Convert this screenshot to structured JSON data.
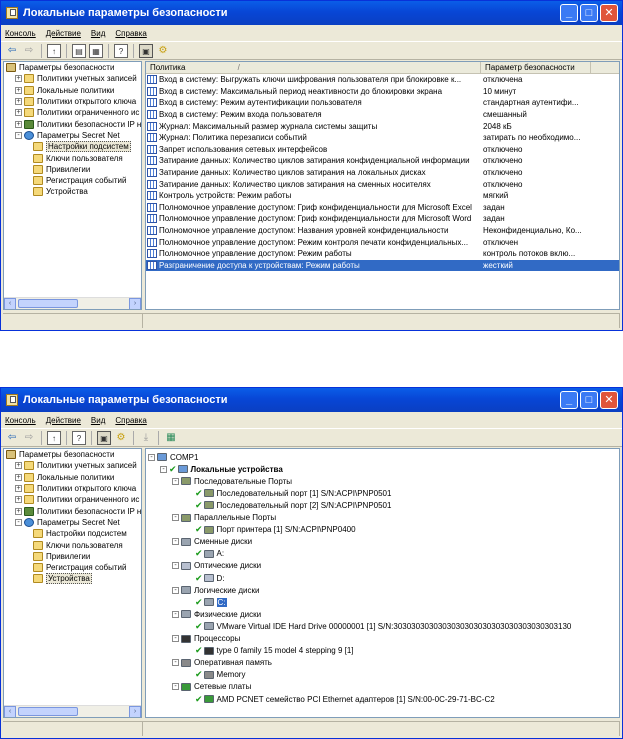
{
  "window_title": "Локальные параметры безопасности",
  "menu": [
    "Консоль",
    "Действие",
    "Вид",
    "Справка"
  ],
  "tree": [
    {
      "label": "Параметры безопасности",
      "level": 0,
      "exp": "",
      "icon": "root"
    },
    {
      "label": "Политики учетных записей",
      "level": 1,
      "exp": "+",
      "icon": "folder"
    },
    {
      "label": "Локальные политики",
      "level": 1,
      "exp": "+",
      "icon": "folder"
    },
    {
      "label": "Политики открытого ключа",
      "level": 1,
      "exp": "+",
      "icon": "folder"
    },
    {
      "label": "Политики ограниченного ис",
      "level": 1,
      "exp": "+",
      "icon": "folder"
    },
    {
      "label": "Политики безопасности IP н",
      "level": 1,
      "exp": "+",
      "icon": "ip"
    },
    {
      "label": "Параметры Secret Net",
      "level": 1,
      "exp": "-",
      "icon": "shield"
    },
    {
      "label": "Настройки подсистем",
      "level": 2,
      "exp": "",
      "icon": "folder"
    },
    {
      "label": "Ключи пользователя",
      "level": 2,
      "exp": "",
      "icon": "folder"
    },
    {
      "label": "Привилегии",
      "level": 2,
      "exp": "",
      "icon": "folder"
    },
    {
      "label": "Регистрация событий",
      "level": 2,
      "exp": "",
      "icon": "folder"
    },
    {
      "label": "Устройства",
      "level": 2,
      "exp": "",
      "icon": "folder"
    }
  ],
  "list": {
    "col_policy": "Политика",
    "col_sort": "/",
    "col_value": "Параметр безопасности",
    "rows": [
      {
        "p": "Вход в систему: Выгружать ключи шифрования пользователя при блокировке к...",
        "v": "отключена"
      },
      {
        "p": "Вход в систему: Максимальный период неактивности до блокировки экрана",
        "v": "10 минут"
      },
      {
        "p": "Вход в систему: Режим аутентификации пользователя",
        "v": "стандартная аутентифи..."
      },
      {
        "p": "Вход в систему: Режим входа пользователя",
        "v": "смешанный"
      },
      {
        "p": "Журнал: Максимальный размер журнала системы защиты",
        "v": "2048 кБ"
      },
      {
        "p": "Журнал: Политика перезаписи событий",
        "v": "затирать по необходимо..."
      },
      {
        "p": "Запрет использования сетевых интерфейсов",
        "v": "отключено"
      },
      {
        "p": "Затирание данных: Количество циклов затирания конфиденциальной информации",
        "v": "отключено"
      },
      {
        "p": "Затирание данных: Количество циклов затирания на локальных дисках",
        "v": "отключено"
      },
      {
        "p": "Затирание данных: Количество циклов затирания на сменных носителях",
        "v": "отключено"
      },
      {
        "p": "Контроль устройств: Режим работы",
        "v": "мягкий"
      },
      {
        "p": "Полномочное управление доступом: Гриф конфиденциальности для Microsoft Excel",
        "v": "задан"
      },
      {
        "p": "Полномочное управление доступом: Гриф конфиденциальности для Microsoft Word",
        "v": "задан"
      },
      {
        "p": "Полномочное управление доступом: Названия уровней конфиденциальности",
        "v": "Неконфиденциально, Ко..."
      },
      {
        "p": "Полномочное управление доступом: Режим контроля печати конфиденциальных...",
        "v": "отключен"
      },
      {
        "p": "Полномочное управление доступом: Режим работы",
        "v": "контроль потоков вклю..."
      },
      {
        "p": "Разграничение доступа к устройствам: Режим работы",
        "v": "жесткий"
      }
    ]
  },
  "devices": [
    {
      "label": "COMP1",
      "x": 12,
      "exp": "-",
      "icon": "comp",
      "chk": false
    },
    {
      "label": "Локальные устройства",
      "x": 24,
      "exp": "-",
      "icon": "comp",
      "chk": true,
      "bold": true
    },
    {
      "label": "Последовательные Порты",
      "x": 36,
      "exp": "-",
      "icon": "port",
      "chk": false
    },
    {
      "label": "Последовательный порт [1] S/N:ACPI\\PNP0501",
      "x": 50,
      "exp": "",
      "icon": "port",
      "chk": true
    },
    {
      "label": "Последовательный порт [2] S/N:ACPI\\PNP0501",
      "x": 50,
      "exp": "",
      "icon": "port",
      "chk": true
    },
    {
      "label": "Параллельные Порты",
      "x": 36,
      "exp": "-",
      "icon": "port",
      "chk": false
    },
    {
      "label": "Порт принтера [1] S/N:ACPI\\PNP0400",
      "x": 50,
      "exp": "",
      "icon": "port",
      "chk": true
    },
    {
      "label": "Сменные диски",
      "x": 36,
      "exp": "-",
      "icon": "drive",
      "chk": false
    },
    {
      "label": "A:",
      "x": 50,
      "exp": "",
      "icon": "drive",
      "chk": true
    },
    {
      "label": "Оптические диски",
      "x": 36,
      "exp": "-",
      "icon": "cd",
      "chk": false
    },
    {
      "label": "D:",
      "x": 50,
      "exp": "",
      "icon": "cd",
      "chk": true
    },
    {
      "label": "Логические диски",
      "x": 36,
      "exp": "-",
      "icon": "drive",
      "chk": false
    },
    {
      "label": "C:",
      "x": 50,
      "exp": "",
      "icon": "drive",
      "chk": true,
      "hl": true
    },
    {
      "label": "Физические диски",
      "x": 36,
      "exp": "-",
      "icon": "drive",
      "chk": false
    },
    {
      "label": "VMware Virtual IDE Hard Drive 00000001 [1] S/N:3030303030303030303030303030303030303130",
      "x": 50,
      "exp": "",
      "icon": "drive",
      "chk": true
    },
    {
      "label": "Процессоры",
      "x": 36,
      "exp": "-",
      "icon": "cpu",
      "chk": false
    },
    {
      "label": "type 0 family 15 model 4 stepping 9 [1]",
      "x": 50,
      "exp": "",
      "icon": "cpu",
      "chk": true
    },
    {
      "label": "Оперативная память",
      "x": 36,
      "exp": "-",
      "icon": "mem",
      "chk": false
    },
    {
      "label": "Memory",
      "x": 50,
      "exp": "",
      "icon": "mem",
      "chk": true
    },
    {
      "label": "Сетевые платы",
      "x": 36,
      "exp": "-",
      "icon": "net",
      "chk": false
    },
    {
      "label": "AMD PCNET семейство PCI Ethernet адаптеров [1] S/N:00-0C-29-71-BC-C2",
      "x": 50,
      "exp": "",
      "icon": "net",
      "chk": true
    }
  ]
}
